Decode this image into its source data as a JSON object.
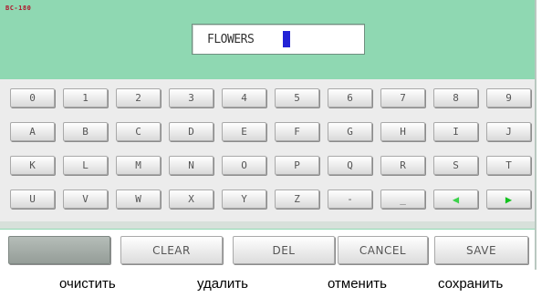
{
  "header": {
    "badge": "BC-180"
  },
  "name_field": {
    "value": "FLOWERS"
  },
  "keyboard": {
    "rows": [
      [
        "0",
        "1",
        "2",
        "3",
        "4",
        "5",
        "6",
        "7",
        "8",
        "9"
      ],
      [
        "A",
        "B",
        "C",
        "D",
        "E",
        "F",
        "G",
        "H",
        "I",
        "J"
      ],
      [
        "K",
        "L",
        "M",
        "N",
        "O",
        "P",
        "Q",
        "R",
        "S",
        "T"
      ],
      [
        "U",
        "V",
        "W",
        "X",
        "Y",
        "Z",
        "-",
        "_",
        "◀",
        "▶"
      ]
    ]
  },
  "actions": {
    "clear_label": "CLEAR",
    "del_label": "DEL",
    "cancel_label": "CANCEL",
    "save_label": "SAVE"
  },
  "captions": {
    "clear": "очистить",
    "delete": "удалить",
    "cancel": "отменить",
    "save": "сохранить"
  },
  "colors": {
    "screen_background": "#8fd8b2",
    "cursor": "#2323d6",
    "arrow_keys": "#12c21e"
  }
}
